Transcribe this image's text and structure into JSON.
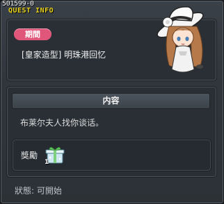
{
  "window": {
    "quest_id": "501599-0",
    "title": "QUEST INFO"
  },
  "period": {
    "badge": "期間",
    "quest_name": "[皇家造型] 明珠港回忆"
  },
  "content": {
    "header": "内容",
    "text": "布莱尔夫人找你谈话。"
  },
  "reward": {
    "label": "獎勵",
    "item_icon": "gift-box-icon",
    "quantity": "1"
  },
  "status": {
    "text": "狀態:  可開始"
  },
  "npc": {
    "icon": "npc-portrait-lady-in-white-hat"
  },
  "colors": {
    "title_yellow": "#e8d21c",
    "badge_pink": "#e0557a",
    "panel_bg": "#2a2f35"
  }
}
